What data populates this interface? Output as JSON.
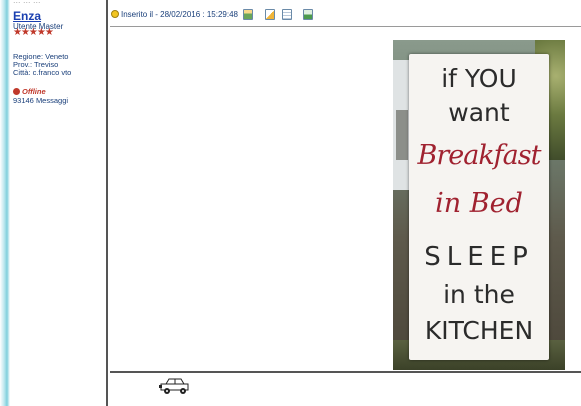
{
  "author": {
    "cut_text": "... ... ...",
    "username": "Enza",
    "rank": "Utente Master",
    "stars": "★★★★★",
    "region": "Regione: Veneto",
    "province": "Prov.: Treviso",
    "city": "Città: c.franco vto",
    "status": "Offline",
    "messages": "93146 Messaggi"
  },
  "post": {
    "posted_label": "Inserito il - 28/02/2016 : 15:29:48",
    "toolbar_icons": [
      "profile-icon",
      "edit-icon",
      "quote-icon",
      "reply-icon"
    ],
    "image": {
      "line1": "if YOU",
      "line2": "want",
      "line3": "Breakfast",
      "line4": "in Bed",
      "line5": "SLEEP",
      "line6": "in the",
      "line7": "KITCHEN"
    }
  },
  "signature": {
    "icon": "car-icon"
  },
  "colors": {
    "link": "#1a3fb0",
    "text": "#1a3f7a",
    "offline": "#c0392b",
    "sign_red": "#a02230"
  }
}
